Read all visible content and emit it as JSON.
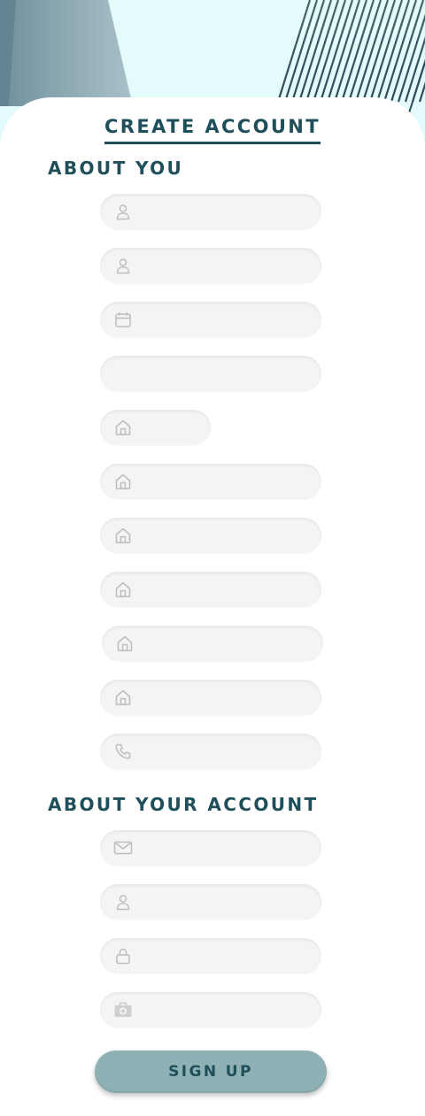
{
  "form": {
    "title": "CREATE ACCOUNT",
    "accent_color": "#1f4f5b",
    "field_background": "#f4f4f4",
    "icon_color": "#bdbdbd"
  },
  "about_you": {
    "heading": "ABOUT YOU",
    "fields": [
      {
        "icon": "user-icon",
        "value": "",
        "placeholder": ""
      },
      {
        "icon": "user-icon",
        "value": "",
        "placeholder": ""
      },
      {
        "icon": "calendar-icon",
        "value": "",
        "placeholder": ""
      },
      {
        "icon": "",
        "value": "",
        "placeholder": ""
      },
      {
        "icon": "home-icon",
        "value": "",
        "placeholder": ""
      },
      {
        "icon": "home-icon",
        "value": "",
        "placeholder": ""
      },
      {
        "icon": "home-icon",
        "value": "",
        "placeholder": ""
      },
      {
        "icon": "home-icon",
        "value": "",
        "placeholder": ""
      },
      {
        "icon": "home-icon",
        "value": "",
        "placeholder": ""
      },
      {
        "icon": "home-icon",
        "value": "",
        "placeholder": ""
      },
      {
        "icon": "phone-icon",
        "value": "",
        "placeholder": ""
      }
    ]
  },
  "about_account": {
    "heading": "ABOUT YOUR ACCOUNT",
    "fields": [
      {
        "icon": "mail-icon",
        "value": "",
        "placeholder": ""
      },
      {
        "icon": "user-icon",
        "value": "",
        "placeholder": ""
      },
      {
        "icon": "lock-icon",
        "value": "",
        "placeholder": ""
      },
      {
        "icon": "medical-kit-icon",
        "value": "",
        "placeholder": ""
      }
    ]
  },
  "actions": {
    "signup_label": "SIGN UP",
    "signup_color": "#8fb0b4"
  }
}
